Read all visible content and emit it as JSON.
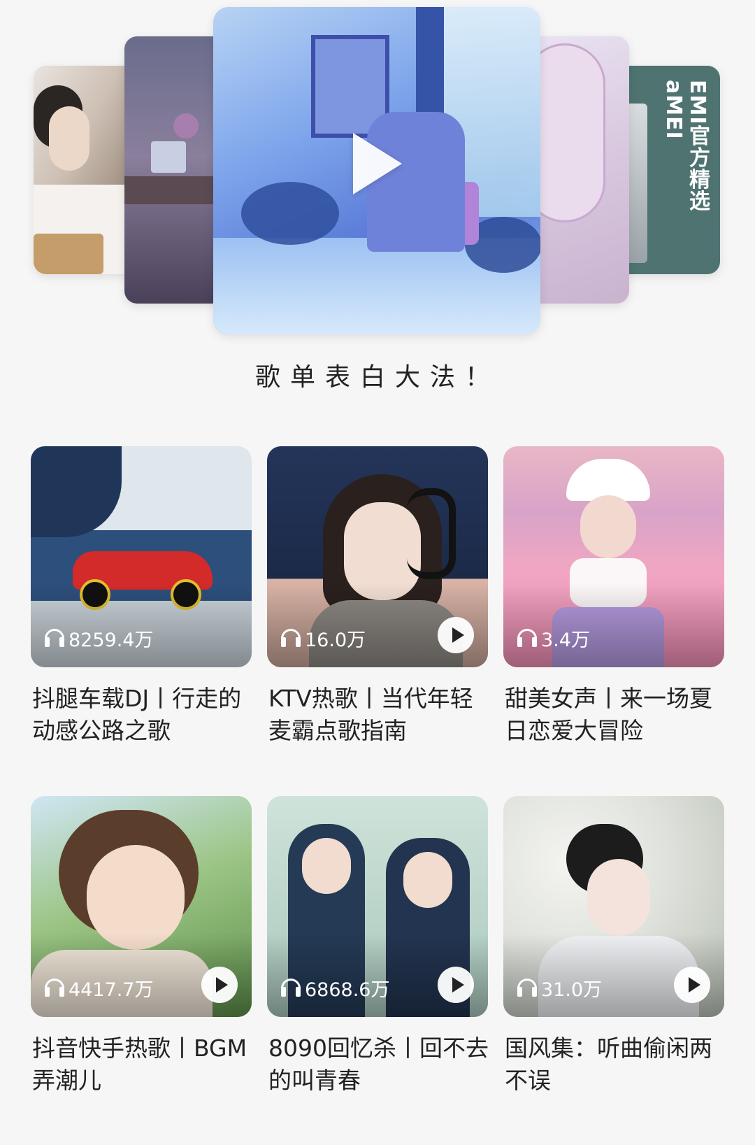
{
  "banner": {
    "title": "歌单表白大法！",
    "side_card_label": "EMI官方精选 aMEI"
  },
  "playlists": [
    {
      "title": "抖腿车载DJ丨行走的动感公路之歌",
      "play_count": "8259.4万",
      "has_play_button": false
    },
    {
      "title": "KTV热歌丨当代年轻麦霸点歌指南",
      "play_count": "16.0万",
      "has_play_button": true
    },
    {
      "title": "甜美女声丨来一场夏日恋爱大冒险",
      "play_count": "3.4万",
      "has_play_button": false
    },
    {
      "title": "抖音快手热歌丨BGM弄潮儿",
      "play_count": "4417.7万",
      "has_play_button": true
    },
    {
      "title": "8090回忆杀丨回不去的叫青春",
      "play_count": "6868.6万",
      "has_play_button": true
    },
    {
      "title": "国风集：听曲偷闲两不误",
      "play_count": "31.0万",
      "has_play_button": true
    }
  ]
}
